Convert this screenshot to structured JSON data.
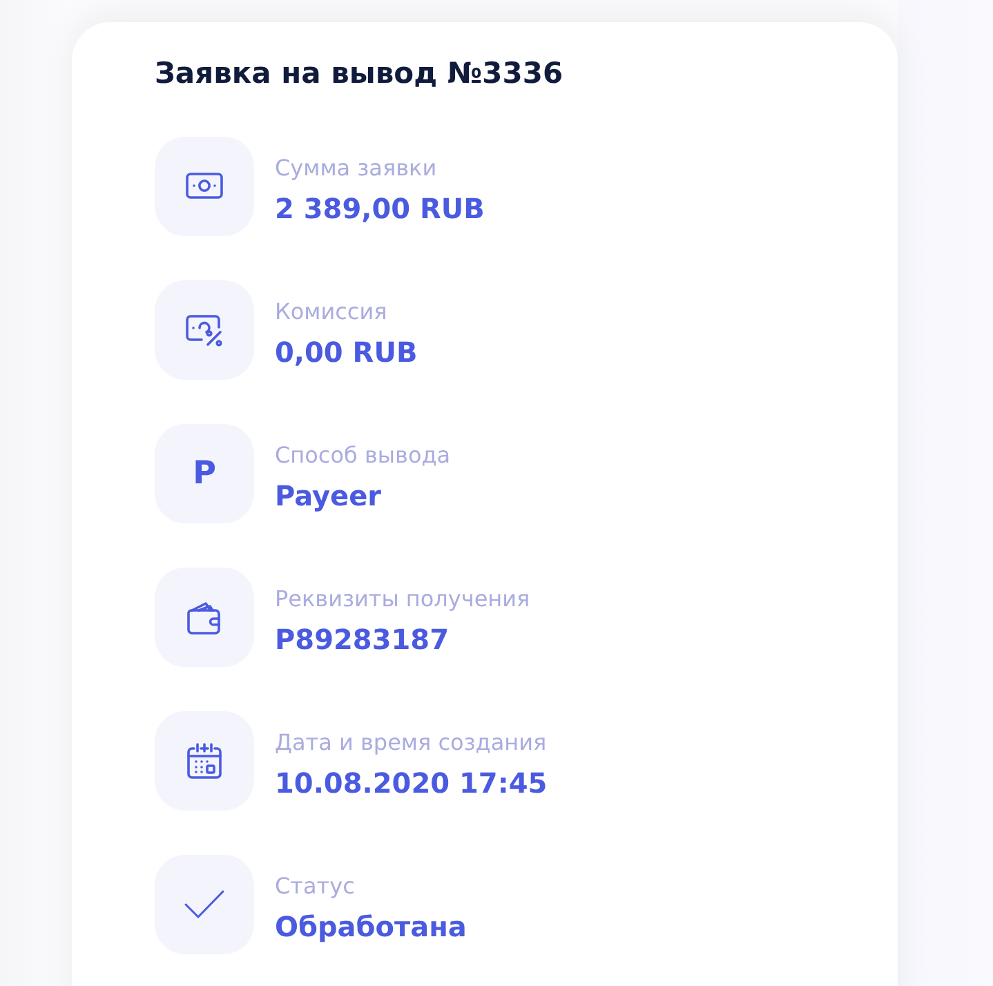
{
  "title": "Заявка на вывод №3336",
  "details": [
    {
      "kind": "cash",
      "label": "Сумма заявки",
      "value": "2 389,00 RUB"
    },
    {
      "kind": "fee",
      "label": "Комиссия",
      "value": "0,00 RUB"
    },
    {
      "kind": "letter",
      "icon_text": "P",
      "label": "Способ вывода",
      "value": "Payeer"
    },
    {
      "kind": "wallet",
      "label": "Реквизиты получения",
      "value": "P89283187"
    },
    {
      "kind": "calendar",
      "label": "Дата и время создания",
      "value": "10.08.2020 17:45"
    },
    {
      "kind": "check",
      "label": "Статус",
      "value": "Обработана"
    }
  ]
}
